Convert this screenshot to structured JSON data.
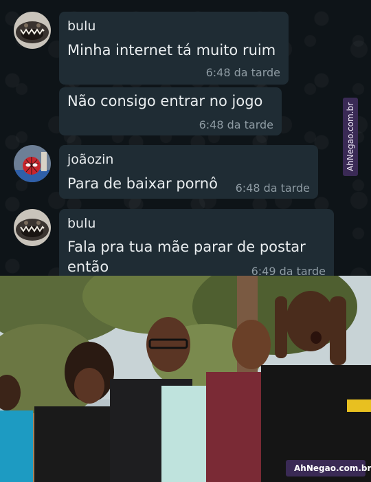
{
  "messages": [
    {
      "sender": "bulu",
      "text": "Minha internet tá muito ruim",
      "time": "6:48 da tarde"
    },
    {
      "text": "Não consigo entrar no jogo",
      "time": "6:48 da tarde"
    },
    {
      "sender": "joãozin",
      "text": "Para de baixar pornô",
      "time": "6:48 da tarde"
    },
    {
      "sender": "bulu",
      "text_line1": "Fala pra tua mãe parar de postar",
      "text_line2": "então",
      "time": "6:49 da tarde"
    }
  ],
  "watermark_side": "AhNegao.com.br",
  "watermark_badge": "AhNegao.com.br",
  "colors": {
    "bubble": "#1f2c34",
    "text": "#e9edef",
    "time": "#8e9ba3",
    "brand": "#3a2a55"
  }
}
